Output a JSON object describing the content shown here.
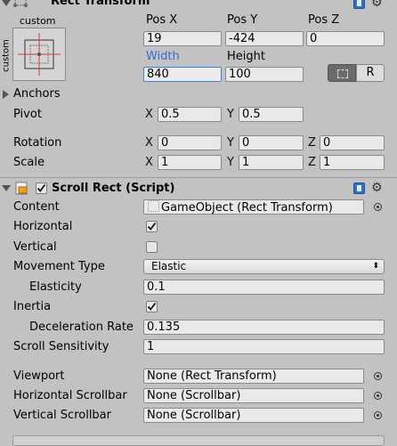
{
  "rect_transform": {
    "title": "Rect Transform",
    "anchor_preset_label": "custom",
    "anchor_side_label": "custom",
    "pos_x_label": "Pos X",
    "pos_y_label": "Pos Y",
    "pos_z_label": "Pos Z",
    "pos_x": "19",
    "pos_y": "-424",
    "pos_z": "0",
    "width_label": "Width",
    "height_label": "Height",
    "width": "840",
    "height": "100",
    "raw_edit_label": "R",
    "anchors_label": "Anchors",
    "pivot_label": "Pivot",
    "pivot_x": "0.5",
    "pivot_y": "0.5",
    "rotation_label": "Rotation",
    "rot_x": "0",
    "rot_y": "0",
    "rot_z": "0",
    "scale_label": "Scale",
    "scale_x": "1",
    "scale_y": "1",
    "scale_z": "1",
    "axis_x": "X",
    "axis_y": "Y",
    "axis_z": "Z"
  },
  "scroll_rect": {
    "title": "Scroll Rect (Script)",
    "content_label": "Content",
    "content_value": "GameObject (Rect Transform)",
    "horizontal_label": "Horizontal",
    "horizontal_checked": true,
    "vertical_label": "Vertical",
    "vertical_checked": false,
    "movement_type_label": "Movement Type",
    "movement_type_value": "Elastic",
    "elasticity_label": "Elasticity",
    "elasticity_value": "0.1",
    "inertia_label": "Inertia",
    "inertia_checked": true,
    "deceleration_label": "Deceleration Rate",
    "deceleration_value": "0.135",
    "scroll_sensitivity_label": "Scroll Sensitivity",
    "scroll_sensitivity_value": "1",
    "viewport_label": "Viewport",
    "viewport_value": "None (Rect Transform)",
    "h_scrollbar_label": "Horizontal Scrollbar",
    "h_scrollbar_value": "None (Scrollbar)",
    "v_scrollbar_label": "Vertical Scrollbar",
    "v_scrollbar_value": "None (Scrollbar)"
  },
  "colors": {
    "background": "#c2c2c2",
    "field": "#e9e9e9",
    "focus_border": "#3f7fd9",
    "width_label": "#2f6fd6",
    "anchor_red": "#d23a3a"
  }
}
